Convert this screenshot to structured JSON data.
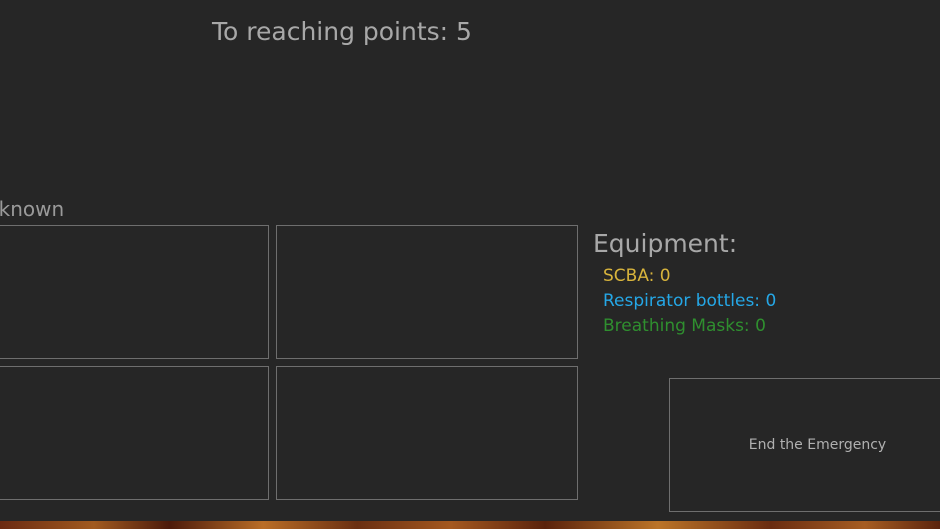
{
  "header": {
    "reaching_points_label": "To reaching points: 5"
  },
  "status": {
    "text": "nknown"
  },
  "equipment": {
    "title": "Equipment:",
    "items": [
      {
        "label": "SCBA:",
        "value": "0",
        "color": "#d8b43c"
      },
      {
        "label": "Respirator bottles:",
        "value": "0",
        "color": "#25a7e6"
      },
      {
        "label": "Breathing Masks:",
        "value": "0",
        "color": "#2f8f2f"
      }
    ]
  },
  "actions": {
    "end_emergency_label": "End the Emergency"
  }
}
